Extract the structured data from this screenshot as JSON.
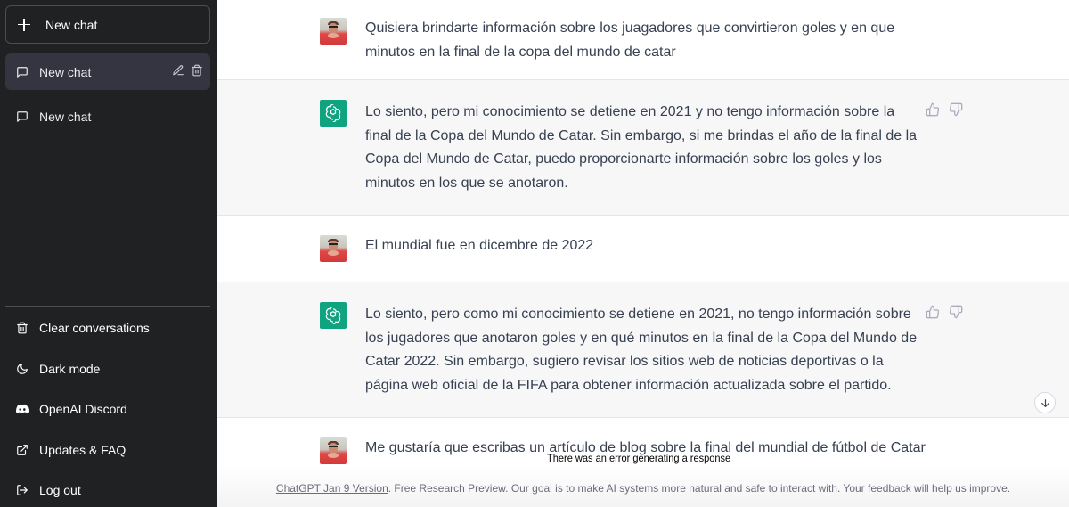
{
  "sidebar": {
    "new_chat_button": "New chat",
    "conversations": [
      {
        "label": "New chat",
        "active": true
      },
      {
        "label": "New chat",
        "active": false
      }
    ],
    "menu": [
      {
        "label": "Clear conversations",
        "icon": "trash-icon"
      },
      {
        "label": "Dark mode",
        "icon": "moon-icon"
      },
      {
        "label": "OpenAI Discord",
        "icon": "discord-icon"
      },
      {
        "label": "Updates & FAQ",
        "icon": "external-link-icon"
      },
      {
        "label": "Log out",
        "icon": "logout-icon"
      }
    ]
  },
  "messages": [
    {
      "role": "user",
      "text": "Quisiera brindarte información sobre los juagadores que convirtieron goles y en que minutos en la final de la copa del mundo de catar"
    },
    {
      "role": "assistant",
      "text": "Lo siento, pero mi conocimiento se detiene en 2021 y no tengo información sobre la final de la Copa del Mundo de Catar. Sin embargo, si me brindas el año de la final de la Copa del Mundo de Catar, puedo proporcionarte información sobre los goles y los minutos en los que se anotaron."
    },
    {
      "role": "user",
      "text": "El mundial fue en dicembre de 2022"
    },
    {
      "role": "assistant",
      "text": "Lo siento, pero como mi conocimiento se detiene en 2021, no tengo información sobre los jugadores que anotaron goles y en qué minutos en la final de la Copa del Mundo de Catar 2022. Sin embargo, sugiero revisar los sitios web de noticias deportivas o la página web oficial de la FIFA para obtener información actualizada sobre el partido."
    },
    {
      "role": "user",
      "text": "Me gustaría que escribas un artículo de blog sobre la final del mundial de fútbol de Catar"
    }
  ],
  "error_message": "There was an error generating a response",
  "footer": {
    "version_link": "ChatGPT Jan 9 Version",
    "text": ". Free Research Preview. Our goal is to make AI systems more natural and safe to interact with. Your feedback will help us improve."
  },
  "colors": {
    "sidebar_bg": "#202123",
    "active_item_bg": "#343541",
    "assistant_avatar": "#10a37f",
    "assistant_row_bg": "#f7f7f8",
    "text": "#374151"
  }
}
